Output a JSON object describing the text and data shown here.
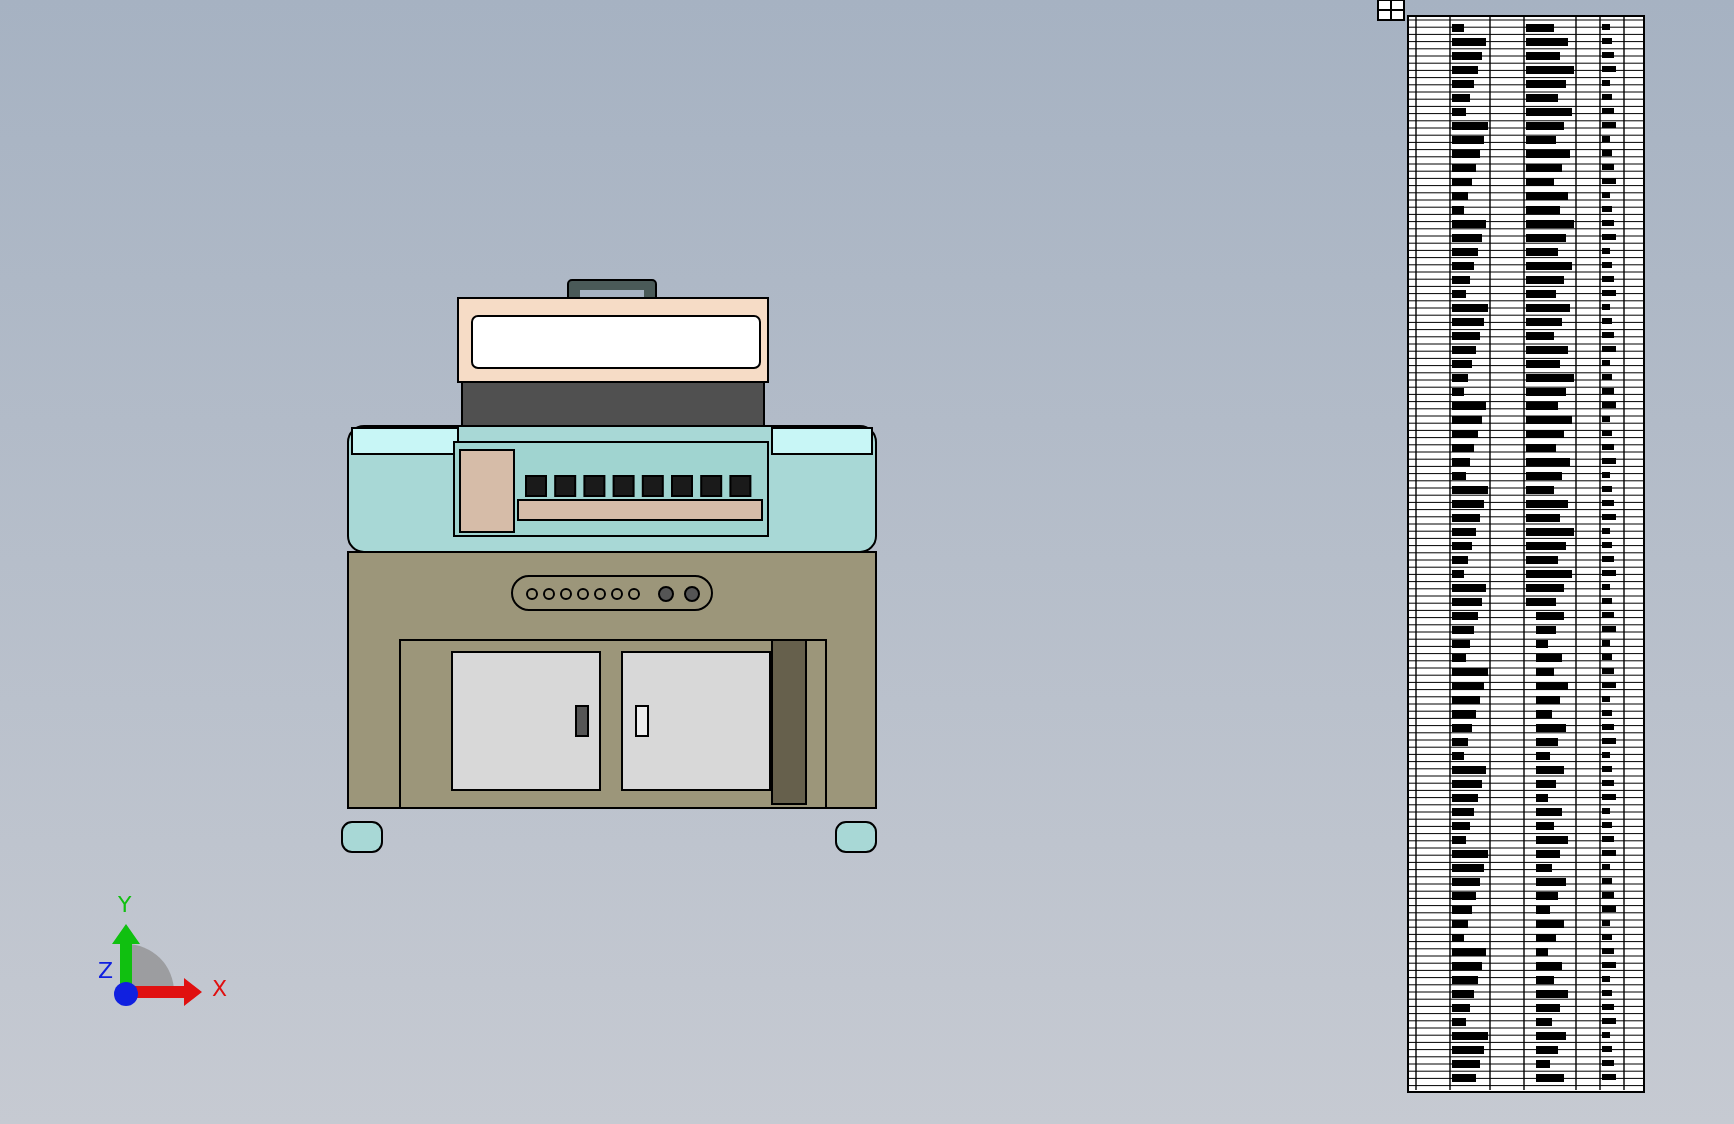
{
  "triad": {
    "axes": [
      {
        "label": "X",
        "color": "#e01010"
      },
      {
        "label": "Y",
        "color": "#10c010"
      },
      {
        "label": "Z",
        "color": "#1020e0"
      }
    ]
  }
}
